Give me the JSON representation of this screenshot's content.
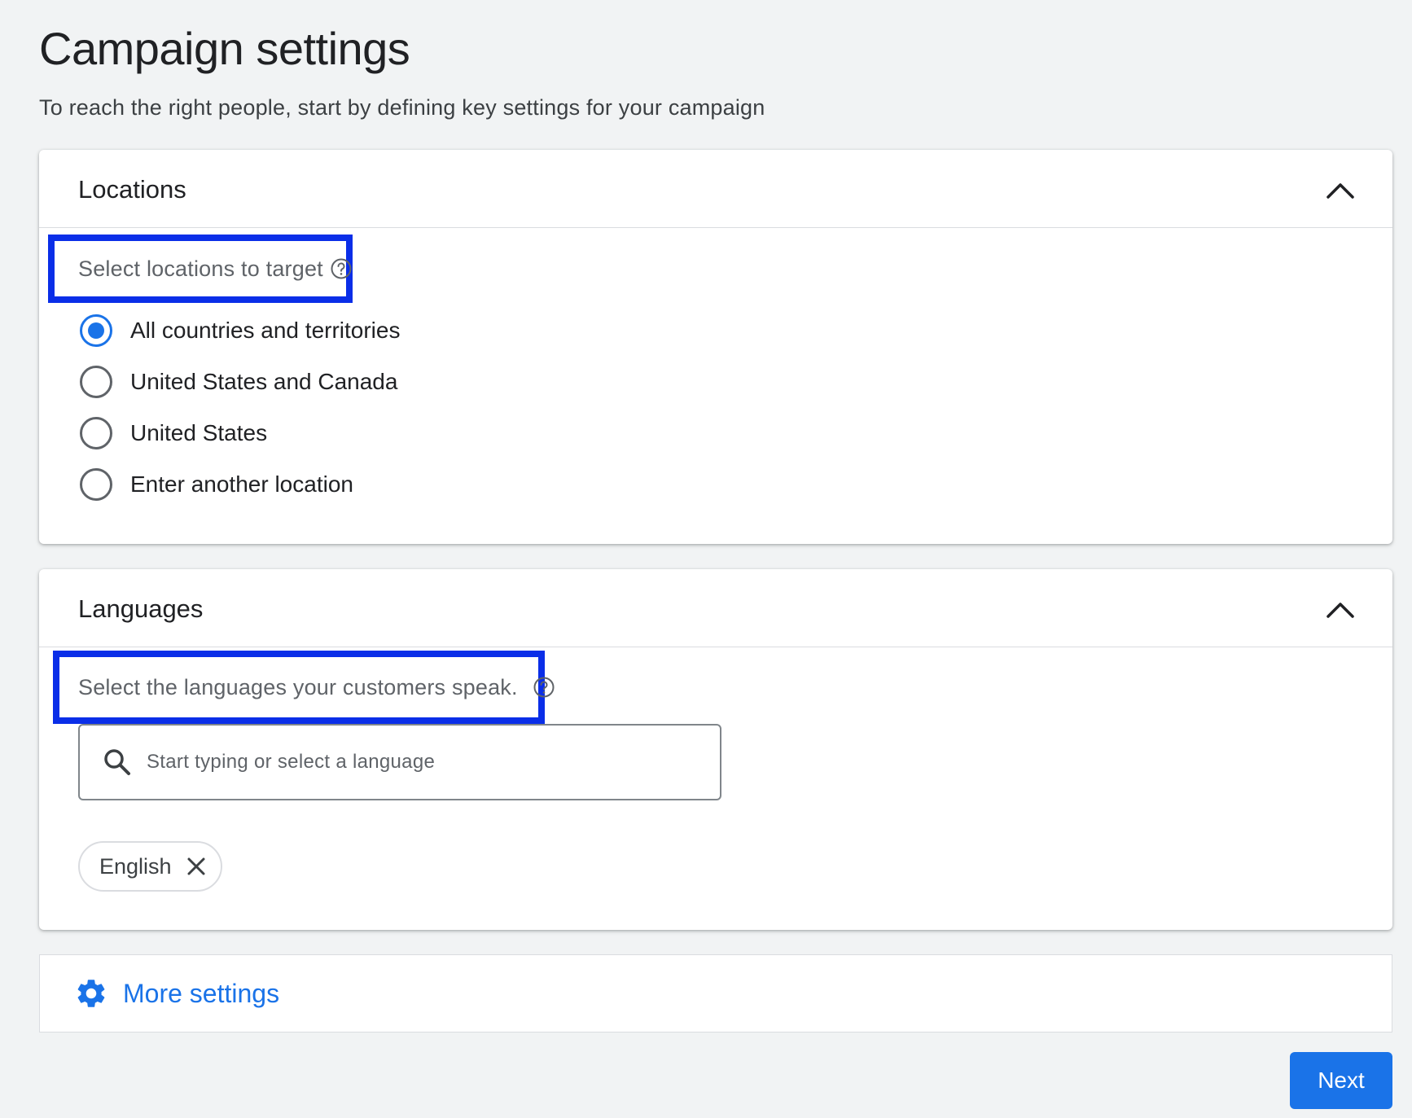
{
  "page": {
    "title": "Campaign settings",
    "subtitle": "To reach the right people, start by defining key settings for your campaign"
  },
  "locations": {
    "title": "Locations",
    "label": "Select locations to target",
    "options": [
      {
        "label": "All countries and territories",
        "checked": true
      },
      {
        "label": "United States and Canada",
        "checked": false
      },
      {
        "label": "United States",
        "checked": false
      },
      {
        "label": "Enter another location",
        "checked": false
      }
    ]
  },
  "languages": {
    "title": "Languages",
    "label": "Select the languages your customers speak.",
    "search": {
      "placeholder": "Start typing or select a language",
      "value": ""
    },
    "selected": [
      {
        "label": "English"
      }
    ]
  },
  "more_settings": {
    "label": "More settings"
  },
  "actions": {
    "next_label": "Next"
  },
  "icons": {
    "collapse": "chevron-up-icon",
    "help": "help-circle-icon",
    "search": "search-icon",
    "remove": "close-icon",
    "settings": "gear-icon"
  },
  "colors": {
    "accent": "#1a73e8",
    "highlight": "#0a2ee8",
    "background": "#f1f3f4"
  }
}
